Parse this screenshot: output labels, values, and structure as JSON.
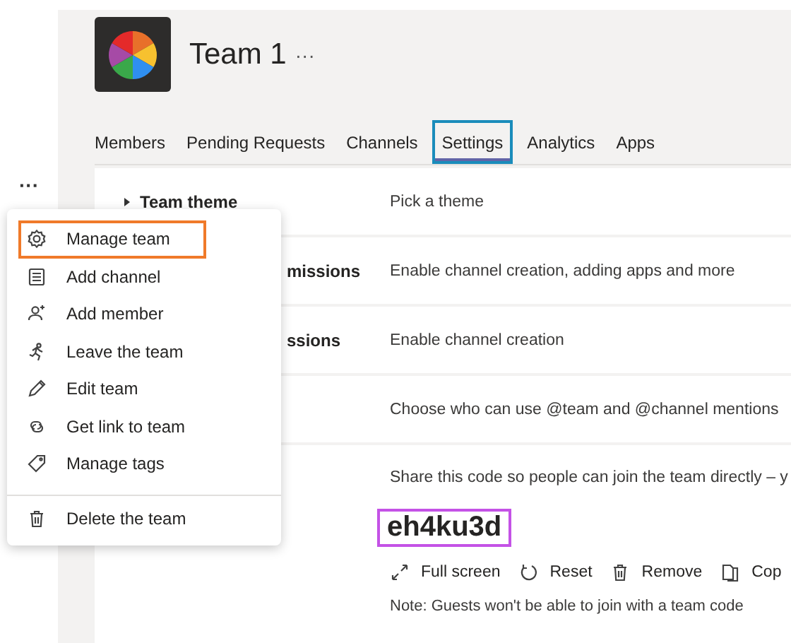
{
  "rail": {
    "more": "···"
  },
  "team": {
    "name": "Team 1",
    "more": "···"
  },
  "tabs": [
    {
      "label": "Members",
      "selected": false
    },
    {
      "label": "Pending Requests",
      "selected": false
    },
    {
      "label": "Channels",
      "selected": false
    },
    {
      "label": "Settings",
      "selected": true
    },
    {
      "label": "Analytics",
      "selected": false
    },
    {
      "label": "Apps",
      "selected": false
    }
  ],
  "settings": [
    {
      "label": "Team theme",
      "description": "Pick a theme"
    },
    {
      "label": "missions",
      "description": "Enable channel creation, adding apps and more"
    },
    {
      "label": "ssions",
      "description": "Enable channel creation"
    },
    {
      "description": "Choose who can use @team and @channel mentions"
    }
  ],
  "team_code": {
    "description": "Share this code so people can join the team directly – y",
    "code": "eh4ku3d",
    "actions": [
      "Full screen",
      "Reset",
      "Remove",
      "Cop"
    ],
    "note": "Note: Guests won't be able to join with a team code"
  },
  "menu": {
    "items": [
      {
        "label": "Manage team",
        "highlighted": true
      },
      {
        "label": "Add channel",
        "highlighted": false
      },
      {
        "label": "Add member",
        "highlighted": false
      },
      {
        "label": "Leave the team",
        "highlighted": false
      },
      {
        "label": "Edit team",
        "highlighted": false
      },
      {
        "label": "Get link to team",
        "highlighted": false
      },
      {
        "label": "Manage tags",
        "highlighted": false
      }
    ],
    "footer_items": [
      {
        "label": "Delete the team",
        "highlighted": false
      }
    ]
  }
}
